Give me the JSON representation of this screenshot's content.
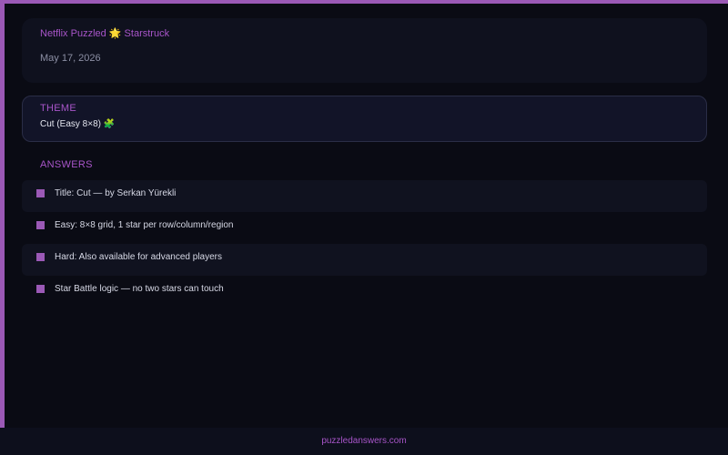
{
  "header": {
    "title": "Netflix Puzzled 🌟 Starstruck",
    "date": "May 17, 2026"
  },
  "theme": {
    "label": "THEME",
    "value": "Cut (Easy 8×8) 🧩"
  },
  "answers": {
    "label": "ANSWERS",
    "items": [
      "Title: Cut — by Serkan Yürekli",
      "Easy: 8×8 grid, 1 star per row/column/region",
      "Hard: Also available for advanced players",
      "Star Battle logic — no two stars can touch"
    ]
  },
  "footer": {
    "link": "puzzledanswers.com"
  },
  "colors": {
    "accent": "#9b59b6",
    "background": "#0a0b14",
    "card": "#0f111e"
  }
}
